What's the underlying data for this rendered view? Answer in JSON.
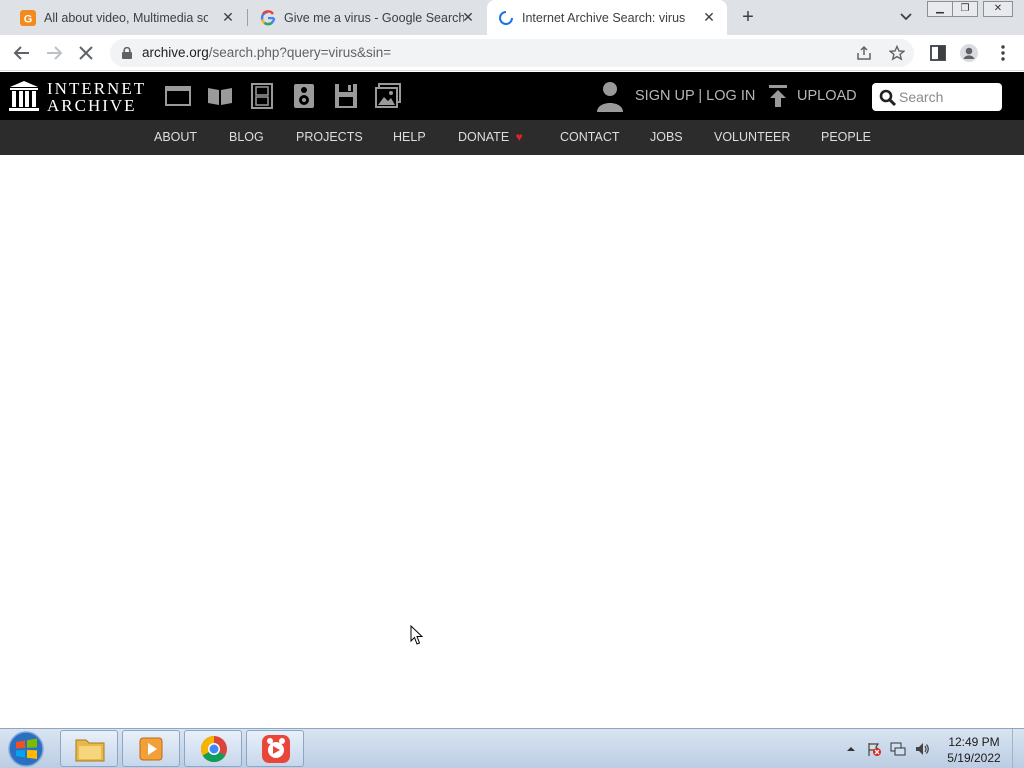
{
  "browser": {
    "tabs": [
      {
        "title": "All about video, Multimedia software",
        "favicon": "orange-g-favicon",
        "active": false
      },
      {
        "title": "Give me a virus - Google Search",
        "favicon": "google-favicon",
        "active": false
      },
      {
        "title": "Internet Archive Search: virus",
        "favicon": "loading-spinner",
        "active": true
      }
    ],
    "new_tab_symbol": "+",
    "close_symbol": "✕",
    "url_host": "archive.org",
    "url_path": "/search.php?query=virus&sin="
  },
  "archive": {
    "logo_line1": "INTERNET",
    "logo_line2": "ARCHIVE",
    "media_icons": [
      "web-icon",
      "texts-icon",
      "video-icon",
      "audio-icon",
      "software-icon",
      "images-icon"
    ],
    "signup_login": "SIGN UP | LOG IN",
    "upload": "UPLOAD",
    "search_placeholder": "Search",
    "nav": [
      "ABOUT",
      "BLOG",
      "PROJECTS",
      "HELP",
      "DONATE",
      "CONTACT",
      "JOBS",
      "VOLUNTEER",
      "PEOPLE"
    ],
    "donate_heart_color": "#e0212a"
  },
  "taskbar": {
    "apps": [
      "file-explorer",
      "media-player",
      "chrome",
      "gom-player"
    ],
    "time": "12:49 PM",
    "date": "5/19/2022"
  }
}
